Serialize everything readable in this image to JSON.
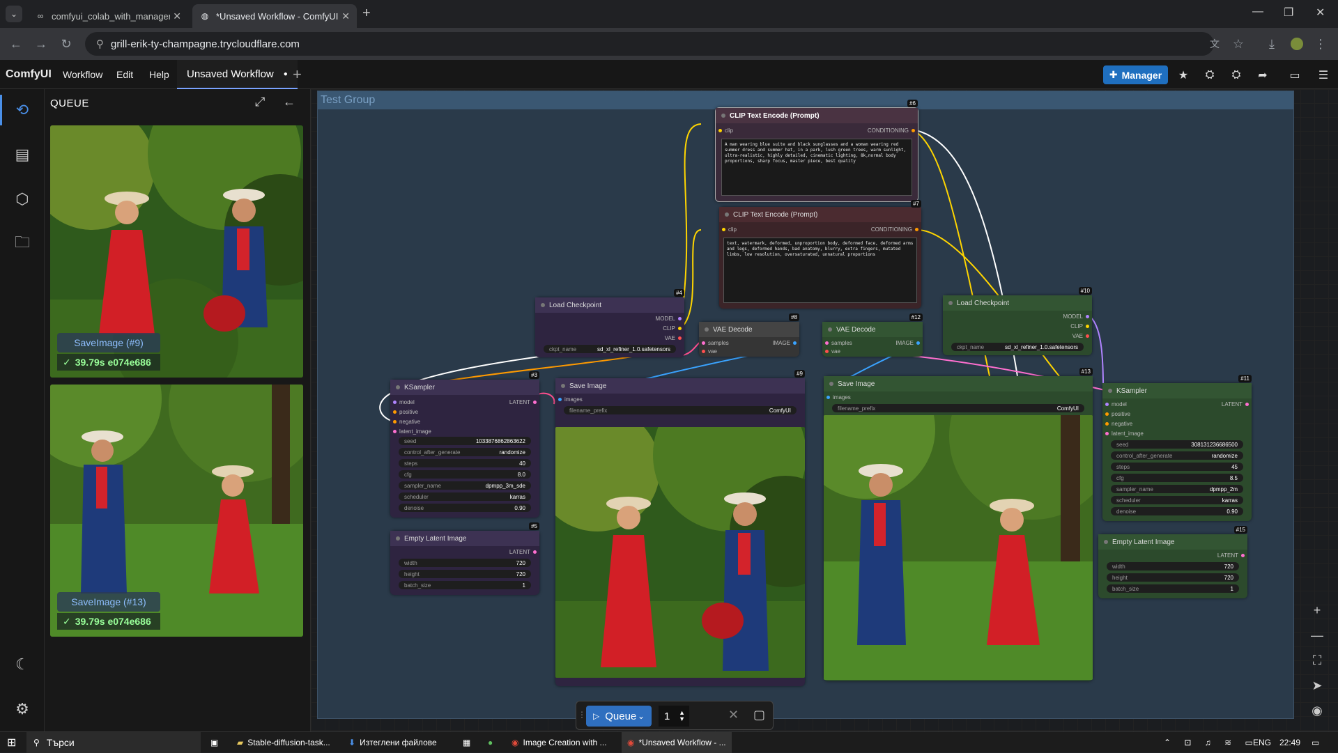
{
  "browser": {
    "tabs": [
      {
        "label": "comfyui_colab_with_manager.ip",
        "active": false
      },
      {
        "label": "*Unsaved Workflow - ComfyUI",
        "active": true
      }
    ],
    "url": "grill-erik-ty-champagne.trycloudflare.com"
  },
  "menubar": {
    "logo": "ComfyUI",
    "items": [
      "Workflow",
      "Edit",
      "Help"
    ],
    "workflow_tab": "Unsaved Workflow",
    "manager_label": "Manager"
  },
  "queue_panel": {
    "title": "QUEUE",
    "items": [
      {
        "label": "SaveImage (#9)",
        "status": "39.79s e074e686"
      },
      {
        "label": "SaveImage (#13)",
        "status": "39.79s e074e686"
      }
    ]
  },
  "canvas": {
    "group_title": "Test Group",
    "nodes": {
      "clip_pos": {
        "id": "#6",
        "title": "CLIP Text Encode (Prompt)",
        "input": "clip",
        "output": "CONDITIONING",
        "text": "A man wearing blue suite and black sunglasses and a woman wearing red summer dress and summer hat, in a park, lush green trees, warm sunlight, ultra-realistic, highly detailed, cinematic lighting, 8k,normal body proportions, sharp focus, master piece, best quality"
      },
      "clip_neg": {
        "id": "#7",
        "title": "CLIP Text Encode (Prompt)",
        "input": "clip",
        "output": "CONDITIONING",
        "text": "text, watermark, deformed, unproportion body, deformed face, deformed arms and legs, deformed hands, bad anatomy, blurry, extra fingers, mutated limbs, low resolution, oversaturated, unnatural proportions"
      },
      "ckpt1": {
        "id": "#4",
        "title": "Load Checkpoint",
        "outputs": [
          "MODEL",
          "CLIP",
          "VAE"
        ],
        "widget_name": "ckpt_name",
        "widget_value": "sd_xl_refiner_1.0.safetensors"
      },
      "vae1": {
        "id": "#8",
        "title": "VAE Decode",
        "inputs": [
          "samples",
          "vae"
        ],
        "output": "IMAGE"
      },
      "vae2": {
        "id": "#12",
        "title": "VAE Decode",
        "inputs": [
          "samples",
          "vae"
        ],
        "output": "IMAGE"
      },
      "ckpt2": {
        "id": "#10",
        "title": "Load Checkpoint",
        "outputs": [
          "MODEL",
          "CLIP",
          "VAE"
        ],
        "widget_name": "ckpt_name",
        "widget_value": "sd_xl_refiner_1.0.safetensors"
      },
      "ks1": {
        "id": "#3",
        "title": "KSampler",
        "inputs": [
          "model",
          "positive",
          "negative",
          "latent_image"
        ],
        "output": "LATENT",
        "widgets": [
          {
            "name": "seed",
            "value": "1033876862863622"
          },
          {
            "name": "control_after_generate",
            "value": "randomize"
          },
          {
            "name": "steps",
            "value": "40"
          },
          {
            "name": "cfg",
            "value": "8.0"
          },
          {
            "name": "sampler_name",
            "value": "dpmpp_3m_sde"
          },
          {
            "name": "scheduler",
            "value": "karras"
          },
          {
            "name": "denoise",
            "value": "0.90"
          }
        ]
      },
      "save1": {
        "id": "#9",
        "title": "Save Image",
        "input": "images",
        "widget_name": "filename_prefix",
        "widget_value": "ComfyUI"
      },
      "save2": {
        "id": "#13",
        "title": "Save Image",
        "input": "images",
        "widget_name": "filename_prefix",
        "widget_value": "ComfyUI"
      },
      "ks2": {
        "id": "#11",
        "title": "KSampler",
        "inputs": [
          "model",
          "positive",
          "negative",
          "latent_image"
        ],
        "output": "LATENT",
        "widgets": [
          {
            "name": "seed",
            "value": "308131236686500"
          },
          {
            "name": "control_after_generate",
            "value": "randomize"
          },
          {
            "name": "steps",
            "value": "45"
          },
          {
            "name": "cfg",
            "value": "8.5"
          },
          {
            "name": "sampler_name",
            "value": "dpmpp_2m"
          },
          {
            "name": "scheduler",
            "value": "karras"
          },
          {
            "name": "denoise",
            "value": "0.90"
          }
        ]
      },
      "latent1": {
        "id": "#5",
        "title": "Empty Latent Image",
        "output": "LATENT",
        "widgets": [
          {
            "name": "width",
            "value": "720"
          },
          {
            "name": "height",
            "value": "720"
          },
          {
            "name": "batch_size",
            "value": "1"
          }
        ]
      },
      "latent2": {
        "id": "#15",
        "title": "Empty Latent Image",
        "output": "LATENT",
        "widgets": [
          {
            "name": "width",
            "value": "720"
          },
          {
            "name": "height",
            "value": "720"
          },
          {
            "name": "batch_size",
            "value": "1"
          }
        ]
      }
    }
  },
  "queue_bar": {
    "button_label": "Queue",
    "count": "1"
  },
  "taskbar": {
    "search": "Търси",
    "items": [
      "Stable-diffusion-task...",
      "Изтеглени файлове",
      "Image Creation with ...",
      "*Unsaved Workflow - ..."
    ],
    "lang": "ENG",
    "time": "22:49"
  }
}
